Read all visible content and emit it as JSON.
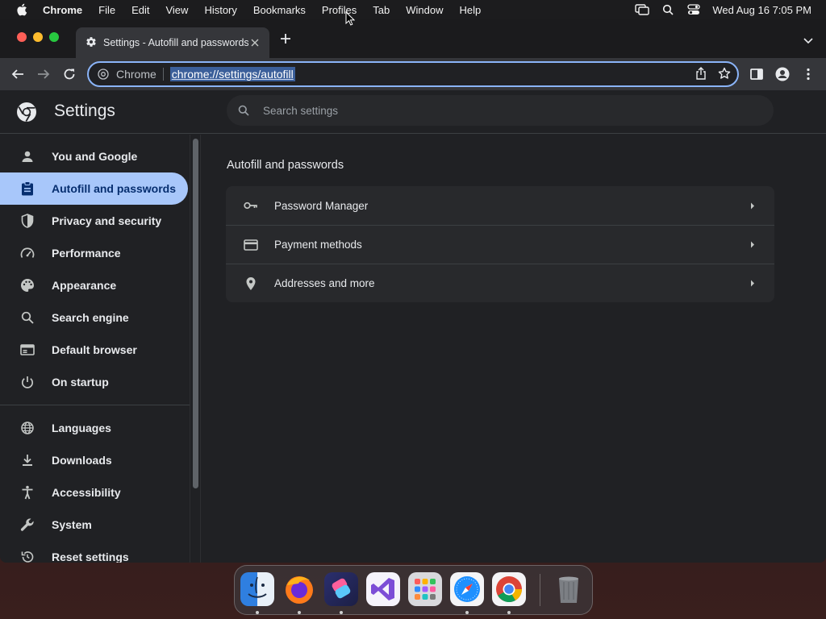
{
  "menubar": {
    "app_name": "Chrome",
    "items": [
      "File",
      "Edit",
      "View",
      "History",
      "Bookmarks",
      "Profiles",
      "Tab",
      "Window",
      "Help"
    ],
    "clock": "Wed Aug 16  7:05 PM",
    "icons": [
      "apple-icon",
      "screen-mirroring-icon",
      "spotlight-search-icon",
      "control-center-icon"
    ]
  },
  "tab": {
    "title": "Settings - Autofill and passwords",
    "icon": "gear-icon"
  },
  "omnibox": {
    "chip_label": "Chrome",
    "url": "chrome://settings/autofill"
  },
  "settings": {
    "title": "Settings",
    "search_placeholder": "Search settings",
    "nav": [
      {
        "label": "You and Google",
        "icon": "person-icon"
      },
      {
        "label": "Autofill and passwords",
        "icon": "clipboard-icon",
        "active": true
      },
      {
        "label": "Privacy and security",
        "icon": "shield-icon"
      },
      {
        "label": "Performance",
        "icon": "speedometer-icon"
      },
      {
        "label": "Appearance",
        "icon": "palette-icon"
      },
      {
        "label": "Search engine",
        "icon": "search-icon"
      },
      {
        "label": "Default browser",
        "icon": "browser-window-icon"
      },
      {
        "label": "On startup",
        "icon": "power-icon"
      }
    ],
    "nav_secondary": [
      {
        "label": "Languages",
        "icon": "globe-icon"
      },
      {
        "label": "Downloads",
        "icon": "download-icon"
      },
      {
        "label": "Accessibility",
        "icon": "accessibility-icon"
      },
      {
        "label": "System",
        "icon": "wrench-icon"
      },
      {
        "label": "Reset settings",
        "icon": "reset-icon"
      }
    ],
    "section_title": "Autofill and passwords",
    "rows": [
      {
        "label": "Password Manager",
        "icon": "key-icon"
      },
      {
        "label": "Payment methods",
        "icon": "credit-card-icon"
      },
      {
        "label": "Addresses and more",
        "icon": "location-pin-icon"
      }
    ]
  },
  "dock": {
    "apps": [
      "Finder",
      "Firefox",
      "Shortcuts",
      "Visual Studio",
      "Launchpad",
      "Safari",
      "Chrome",
      "Trash"
    ]
  },
  "colors": {
    "accent": "#a8c7fa",
    "omnibox_border": "#8ab4f8",
    "background": "#202124"
  }
}
